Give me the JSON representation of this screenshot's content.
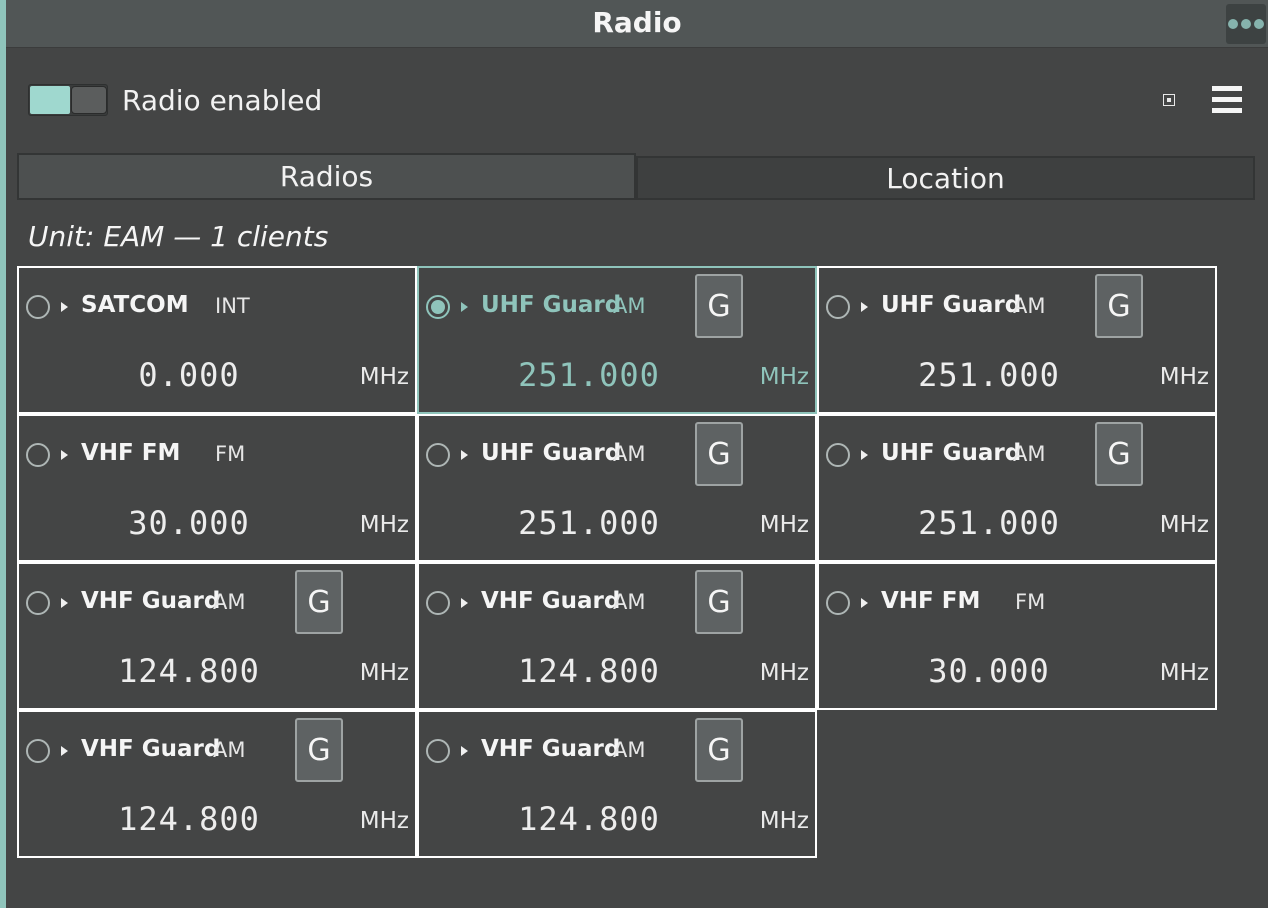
{
  "window": {
    "title": "Radio",
    "more_icon": "more-dots-icon"
  },
  "colors": {
    "accent": "#8fc4bb",
    "background": "#444545",
    "titlebar": "#515656",
    "card_border": "#ffffff"
  },
  "controls": {
    "radio_enabled_label": "Radio enabled",
    "radio_enabled": true,
    "popout_icon": "popout-icon",
    "menu_icon": "hamburger-menu-icon"
  },
  "tabs": [
    {
      "label": "Radios",
      "active": true
    },
    {
      "label": "Location",
      "active": false
    }
  ],
  "unit_label": "Unit: EAM — 1 clients",
  "radios": [
    {
      "name": "SATCOM",
      "modulation": "INT",
      "guard": "",
      "frequency": "0.000",
      "unit": "MHz",
      "selected": false
    },
    {
      "name": "UHF Guard",
      "modulation": "AM",
      "guard": "G",
      "frequency": "251.000",
      "unit": "MHz",
      "selected": true
    },
    {
      "name": "UHF Guard",
      "modulation": "AM",
      "guard": "G",
      "frequency": "251.000",
      "unit": "MHz",
      "selected": false
    },
    {
      "name": "VHF FM",
      "modulation": "FM",
      "guard": "",
      "frequency": "30.000",
      "unit": "MHz",
      "selected": false
    },
    {
      "name": "UHF Guard",
      "modulation": "AM",
      "guard": "G",
      "frequency": "251.000",
      "unit": "MHz",
      "selected": false
    },
    {
      "name": "UHF Guard",
      "modulation": "AM",
      "guard": "G",
      "frequency": "251.000",
      "unit": "MHz",
      "selected": false
    },
    {
      "name": "VHF Guard",
      "modulation": "AM",
      "guard": "G",
      "frequency": "124.800",
      "unit": "MHz",
      "selected": false
    },
    {
      "name": "VHF Guard",
      "modulation": "AM",
      "guard": "G",
      "frequency": "124.800",
      "unit": "MHz",
      "selected": false
    },
    {
      "name": "VHF FM",
      "modulation": "FM",
      "guard": "",
      "frequency": "30.000",
      "unit": "MHz",
      "selected": false
    },
    {
      "name": "VHF Guard",
      "modulation": "AM",
      "guard": "G",
      "frequency": "124.800",
      "unit": "MHz",
      "selected": false
    },
    {
      "name": "VHF Guard",
      "modulation": "AM",
      "guard": "G",
      "frequency": "124.800",
      "unit": "MHz",
      "selected": false
    }
  ]
}
